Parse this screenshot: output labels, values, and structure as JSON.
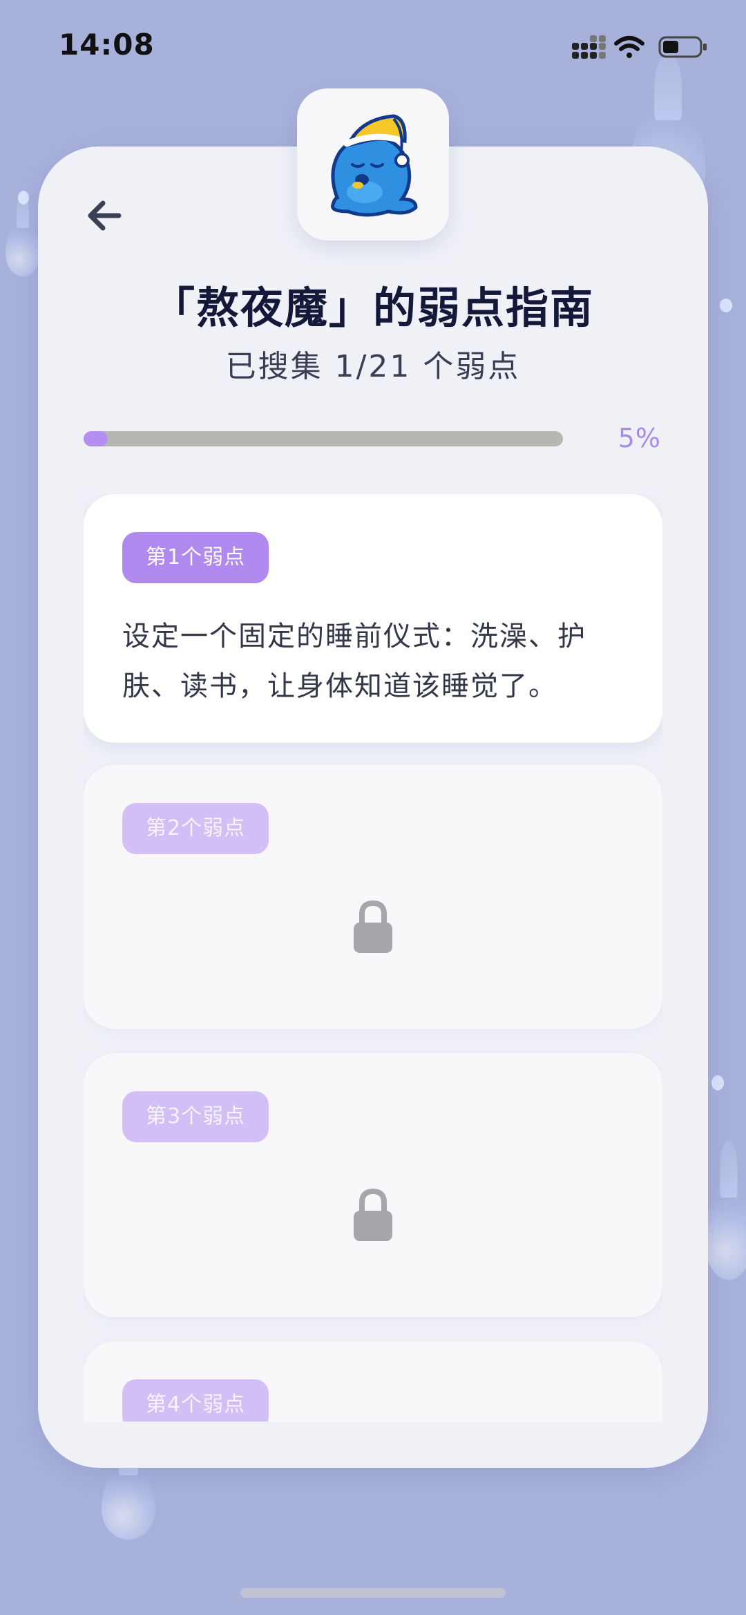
{
  "status_bar": {
    "time": "14:08"
  },
  "header": {
    "title": "「熬夜魔」的弱点指南",
    "subtitle": "已搜集 1/21 个弱点"
  },
  "progress": {
    "value": 0.05,
    "label": "5%"
  },
  "weaknesses": [
    {
      "badge": "第1个弱点",
      "text": "设定一个固定的睡前仪式：洗澡、护肤、读书，让身体知道该睡觉了。",
      "locked": false
    },
    {
      "badge": "第2个弱点",
      "locked": true
    },
    {
      "badge": "第3个弱点",
      "locked": true
    },
    {
      "badge": "第4个弱点",
      "locked": true
    }
  ],
  "colors": {
    "background": "#a7b1da",
    "accent": "#b089ee",
    "accent_light": "#d1bff5",
    "card": "#f0f1f7"
  },
  "icons": {
    "back": "arrow-left-icon",
    "lock": "lock-icon",
    "mascot": "sleepy-monster-mascot"
  }
}
